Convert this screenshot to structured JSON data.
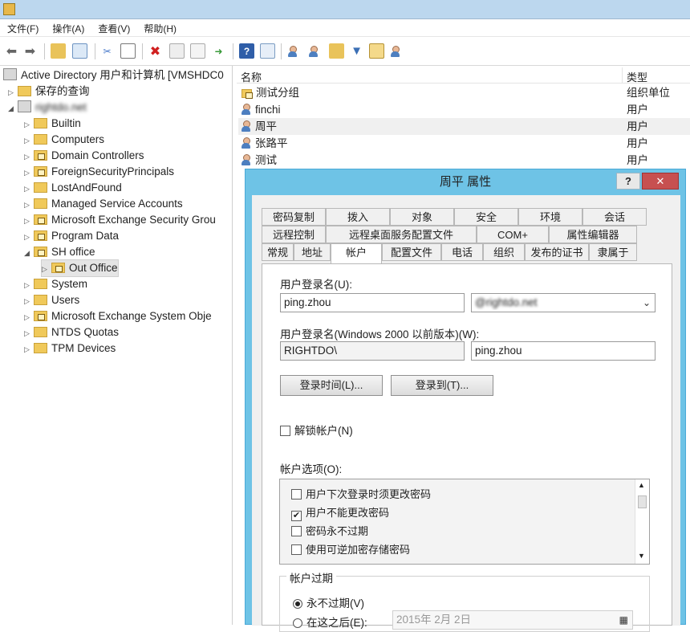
{
  "menu": [
    "文件(F)",
    "操作(A)",
    "查看(V)",
    "帮助(H)"
  ],
  "tree": {
    "root": "Active Directory 用户和计算机 [VMSHDC0",
    "saved_queries": "保存的查询",
    "domain": "rightdo.net",
    "nodes": [
      "Builtin",
      "Computers",
      "Domain Controllers",
      "ForeignSecurityPrincipals",
      "LostAndFound",
      "Managed Service Accounts",
      "Microsoft Exchange Security Grou",
      "Program Data",
      "SH office"
    ],
    "child": "Out Office",
    "nodes_after": [
      "System",
      "Users",
      "Microsoft Exchange System Obje",
      "NTDS Quotas",
      "TPM Devices"
    ]
  },
  "list": {
    "col_name": "名称",
    "col_type": "类型",
    "rows": [
      {
        "name": "测试分组",
        "type": "组织单位",
        "icon": "folder-icon"
      },
      {
        "name": "finchi",
        "type": "用户",
        "icon": "user-icon"
      },
      {
        "name": "周平",
        "type": "用户",
        "icon": "user-icon"
      },
      {
        "name": "张路平",
        "type": "用户",
        "icon": "user-icon"
      },
      {
        "name": "测试",
        "type": "用户",
        "icon": "user-icon"
      }
    ]
  },
  "dialog": {
    "title": "周平 属性",
    "help": "?",
    "close": "✕",
    "tabs_row1": [
      "密码复制",
      "拨入",
      "对象",
      "安全",
      "环境",
      "会话"
    ],
    "tabs_row2": [
      "远程控制",
      "远程桌面服务配置文件",
      "COM+",
      "属性编辑器"
    ],
    "tabs_row3": [
      "常规",
      "地址",
      "帐户",
      "配置文件",
      "电话",
      "组织",
      "发布的证书",
      "隶属于"
    ],
    "logon_label": "用户登录名(U):",
    "logon_value": "ping.zhou",
    "domain_value": "@rightdo.net",
    "pre2000_label": "用户登录名(Windows 2000 以前版本)(W):",
    "pre2000_domain": "RIGHTDO\\",
    "pre2000_user": "ping.zhou",
    "btn_hours": "登录时间(L)...",
    "btn_logon_to": "登录到(T)...",
    "unlock": "解锁帐户(N)",
    "options_label": "帐户选项(O):",
    "options": [
      {
        "label": "用户下次登录时须更改密码",
        "checked": false
      },
      {
        "label": "用户不能更改密码",
        "checked": true
      },
      {
        "label": "密码永不过期",
        "checked": false
      },
      {
        "label": "使用可逆加密存储密码",
        "checked": false
      }
    ],
    "expire_label": "帐户过期",
    "never": "永不过期(V)",
    "end_of": "在这之后(E):",
    "date_value": "2015年  2月  2日"
  }
}
